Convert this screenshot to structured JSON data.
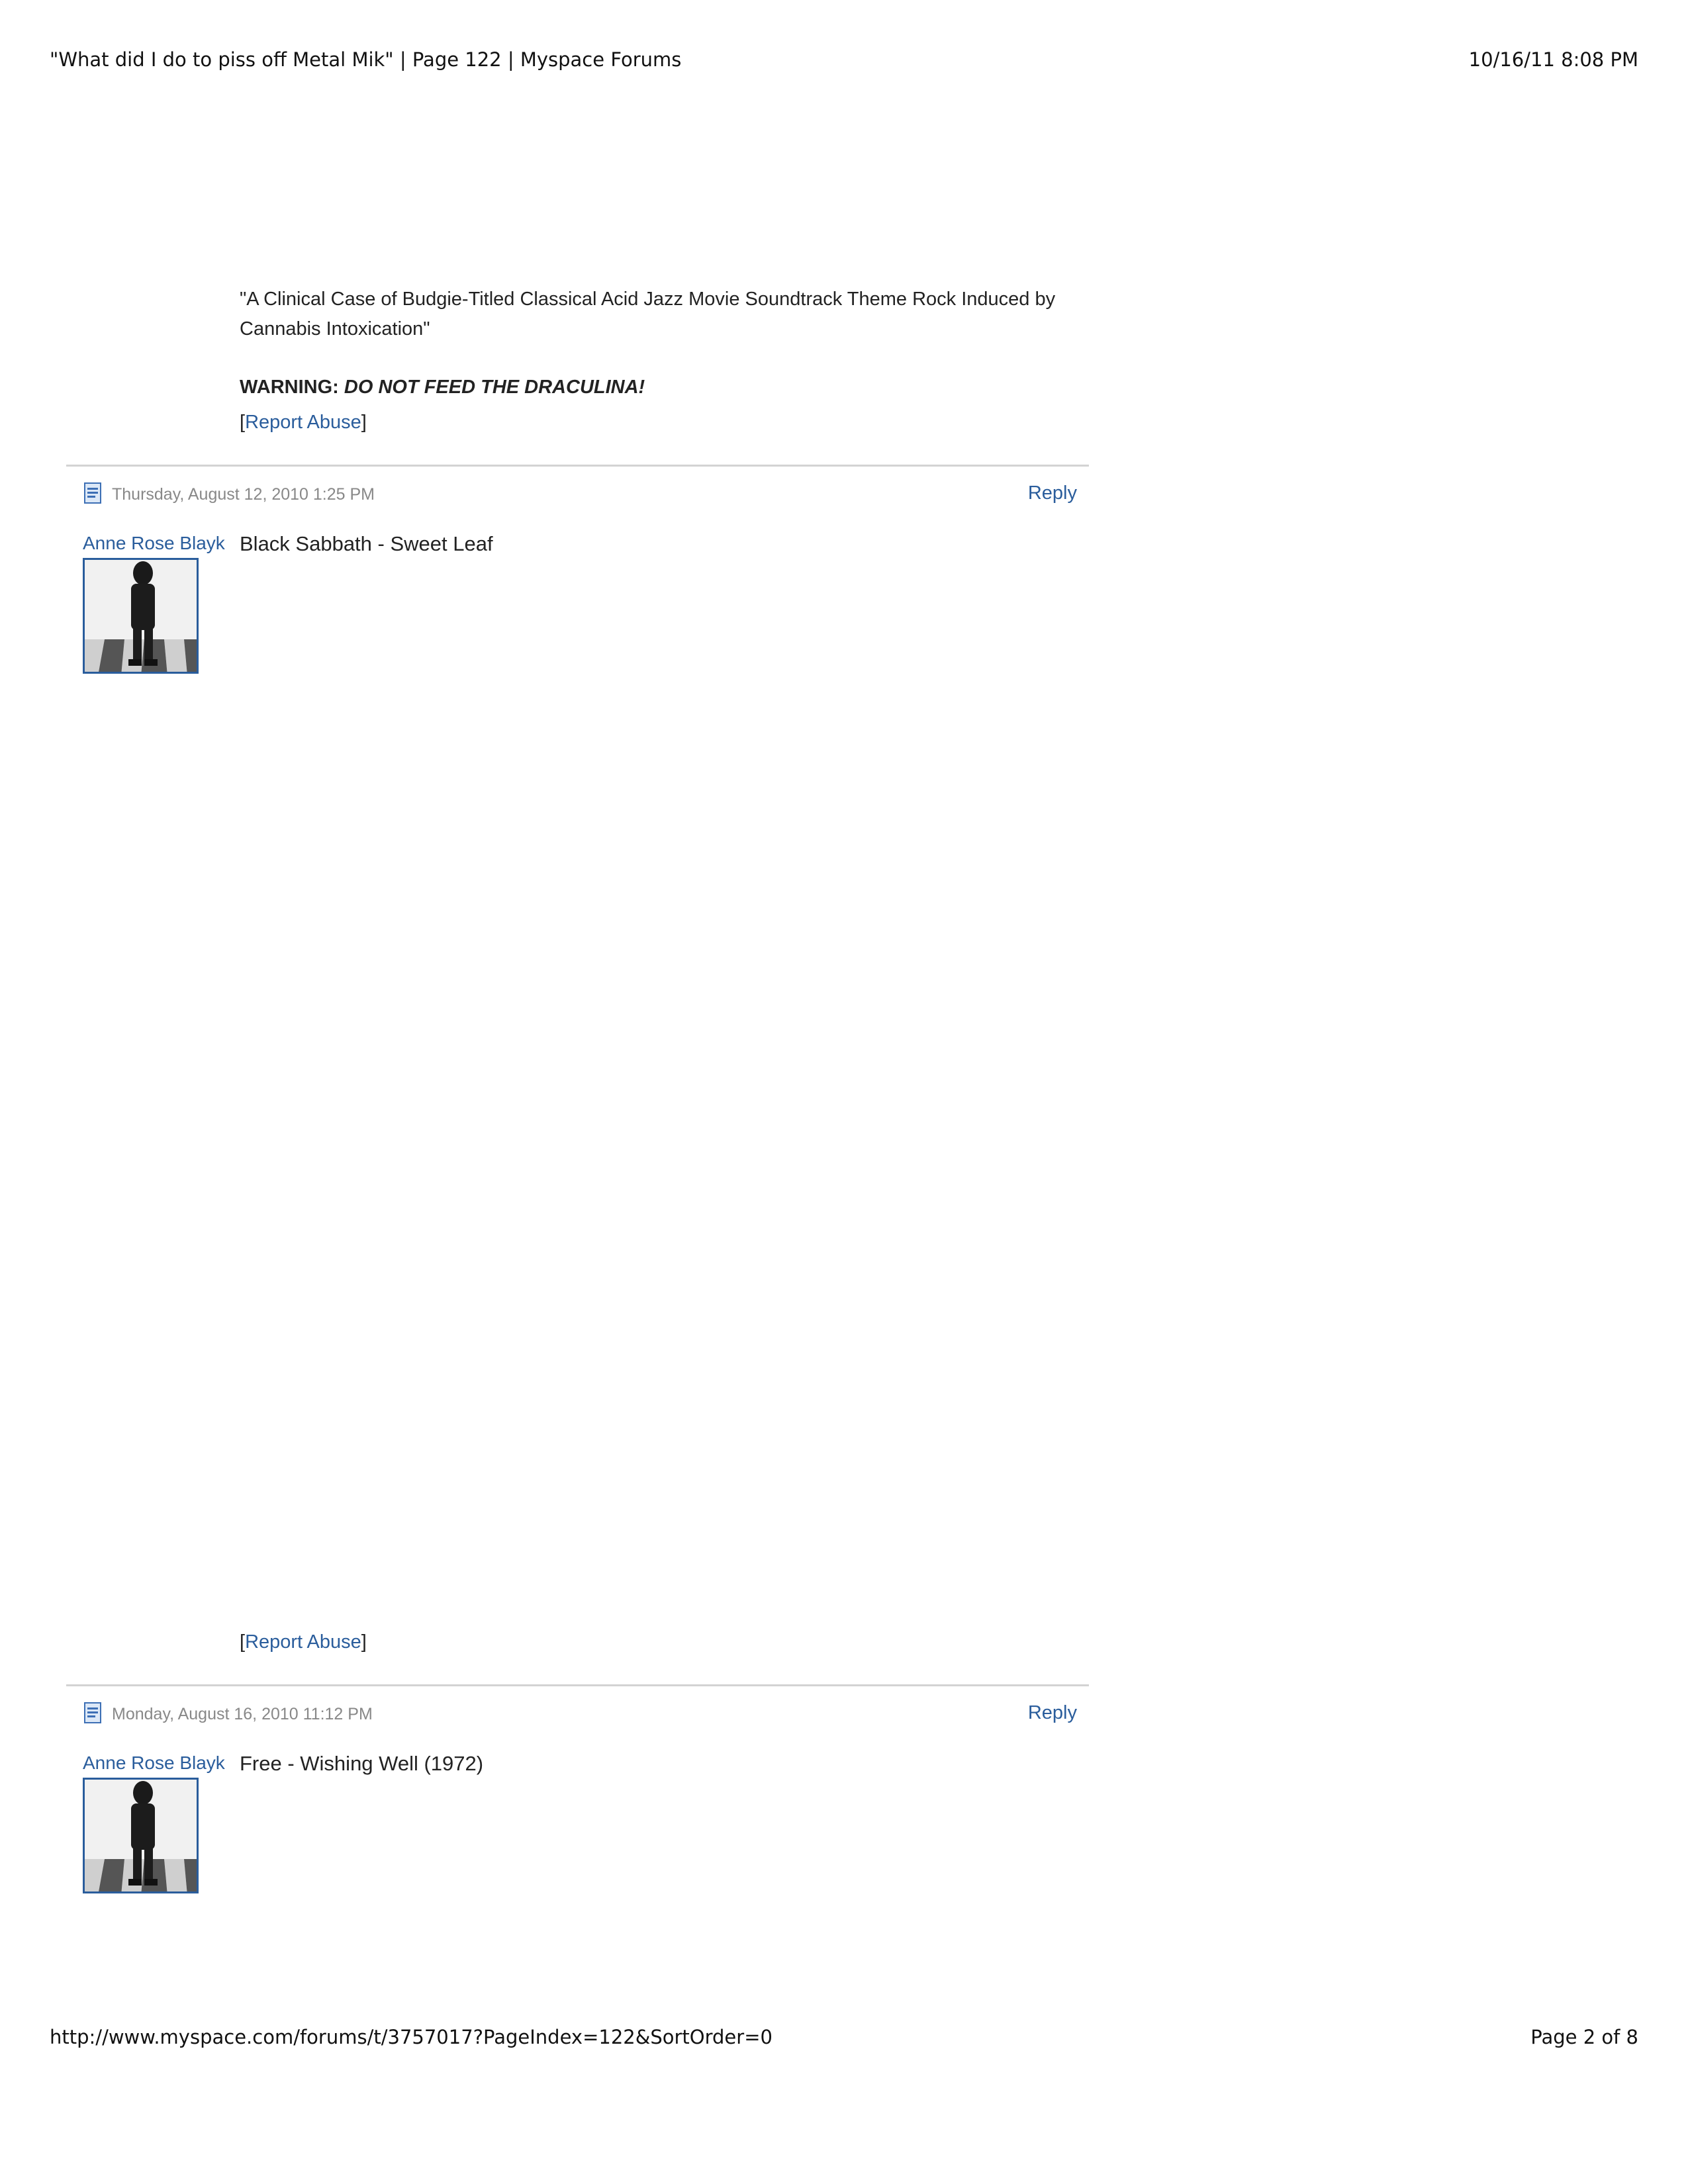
{
  "header": {
    "page_title": "\"What did I do to piss off Metal Mik\" | Page 122 | Myspace Forums",
    "printed_at": "10/16/11 8:08 PM"
  },
  "previous_post": {
    "signature_quote": "\"A Clinical Case of Budgie-Titled Classical Acid Jazz Movie Soundtrack Theme Rock Induced by Cannabis Intoxication\"",
    "warning_label": "WARNING:",
    "warning_text": "DO NOT FEED THE DRACULINA!",
    "report_abuse": "Report Abuse"
  },
  "posts": [
    {
      "date": "Thursday, August 12, 2010 1:25 PM",
      "reply": "Reply",
      "author": "Anne Rose Blayk",
      "body": "Black Sabbath - Sweet Leaf",
      "report_abuse": "Report Abuse"
    },
    {
      "date": "Monday, August 16, 2010 11:12 PM",
      "reply": "Reply",
      "author": "Anne Rose Blayk",
      "body": "Free - Wishing Well (1972)"
    }
  ],
  "footer": {
    "url": "http://www.myspace.com/forums/t/3757017?PageIndex=122&SortOrder=0",
    "page_number": "Page 2 of 8"
  },
  "colors": {
    "link": "#2a5d9c",
    "meta_text": "#888888",
    "divider": "#d3d3d3"
  },
  "icons": {
    "post": "document-icon",
    "avatar": "user-avatar"
  }
}
